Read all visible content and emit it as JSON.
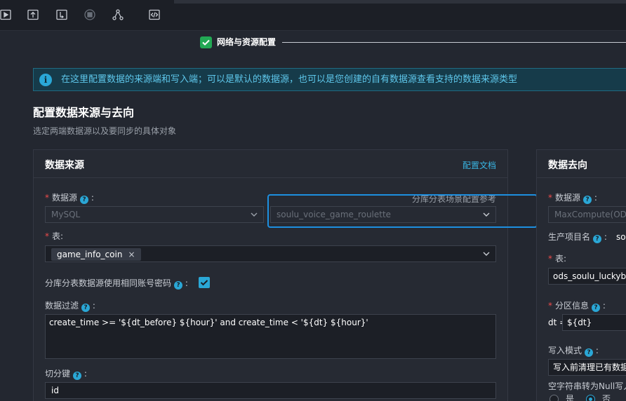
{
  "toolbar": {
    "icons": [
      "run-icon",
      "publish-icon",
      "format-icon",
      "stop-icon",
      "share-icon",
      "code-icon"
    ]
  },
  "steps": {
    "current": "网络与资源配置"
  },
  "banner": {
    "text": "在这里配置数据的来源端和写入端；可以是默认的数据源，也可以是您创建的自有数据源查看支持的数据来源类型"
  },
  "section": {
    "title": "配置数据来源与去向",
    "subtitle": "选定两端数据源以及要同步的具体对象"
  },
  "source": {
    "title": "数据来源",
    "doc_link": "配置文档",
    "datasource_label": "数据源",
    "datasource_type": "MySQL",
    "datasource_name": "soulu_voice_game_roulette",
    "sharding_hint": "分库分表场景配置参考",
    "table_label": "表:",
    "table_tag": "game_info_coin",
    "same_account_label": "分库分表数据源使用相同账号密码",
    "filter_label": "数据过滤",
    "filter_value": "create_time >= '${dt_before} ${hour}' and create_time < '${dt} ${hour}'",
    "split_key_label": "切分键",
    "split_key_value": "id"
  },
  "target": {
    "title": "数据去向",
    "datasource_label": "数据源",
    "datasource_type": "MaxCompute(ODPS)",
    "project_label": "生产项目名",
    "project_value": "so",
    "table_label": "表:",
    "table_value": "ods_soulu_luckybox",
    "partition_label": "分区信息",
    "partition_prefix": "dt =",
    "partition_value": "${dt}",
    "write_mode_label": "写入模式",
    "write_mode_value": "写入前清理已有数据",
    "empty_to_null_label": "空字符串转为Null写入",
    "radio_yes": "是",
    "radio_no": "否"
  }
}
